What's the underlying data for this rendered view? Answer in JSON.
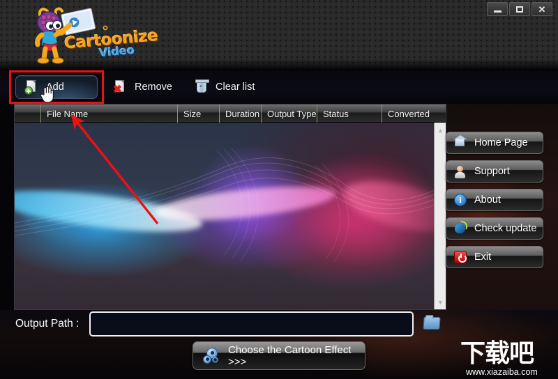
{
  "window": {
    "title": "Cartoonize Video",
    "controls": [
      {
        "name": "minimize",
        "label": "—"
      },
      {
        "name": "maximize",
        "label": "□"
      },
      {
        "name": "close",
        "label": "X"
      }
    ]
  },
  "logo": {
    "word1": "Cartoonize",
    "word2": "Video",
    "mascot": "armadillo-mascot-icon",
    "colors": {
      "word1": "#f5a31e",
      "word2": "#4aa8e8"
    }
  },
  "toolbar": {
    "items": [
      {
        "id": "add",
        "label": "Add",
        "icon": "add-file-icon",
        "highlighted": true
      },
      {
        "id": "remove",
        "label": "Remove",
        "icon": "remove-file-icon",
        "highlighted": false
      },
      {
        "id": "clear",
        "label": "Clear list",
        "icon": "recycle-bin-icon",
        "highlighted": false
      }
    ]
  },
  "file_list": {
    "columns": [
      {
        "label": "",
        "width": 38
      },
      {
        "label": "File Name",
        "width": 196
      },
      {
        "label": "Size",
        "width": 60
      },
      {
        "label": "Duration",
        "width": 60
      },
      {
        "label": "Output Type",
        "width": 80
      },
      {
        "label": "Status",
        "width": 93
      },
      {
        "label": "Converted",
        "width": 69
      }
    ],
    "rows": [],
    "scrollbar": {
      "up": "▲",
      "down": "▼"
    }
  },
  "sidebar": {
    "buttons": [
      {
        "label": "Home Page",
        "icon": "house-icon"
      },
      {
        "label": "Support",
        "icon": "person-icon"
      },
      {
        "label": "About",
        "icon": "info-icon"
      },
      {
        "label": "Check update",
        "icon": "globe-icon"
      },
      {
        "label": "Exit",
        "icon": "power-icon"
      }
    ]
  },
  "output": {
    "label": "Output Path :",
    "value": "",
    "placeholder": "",
    "browse_icon": "folder-icon"
  },
  "action": {
    "label": "Choose the Cartoon Effect >>>",
    "icon": "gears-icon"
  },
  "annotations": {
    "highlight_color": "#ee1111",
    "arrow": "red-arrow-pointing-to-file-name"
  },
  "watermark": {
    "text_cn": "下载吧",
    "url": "www.xiazaiba.com"
  }
}
